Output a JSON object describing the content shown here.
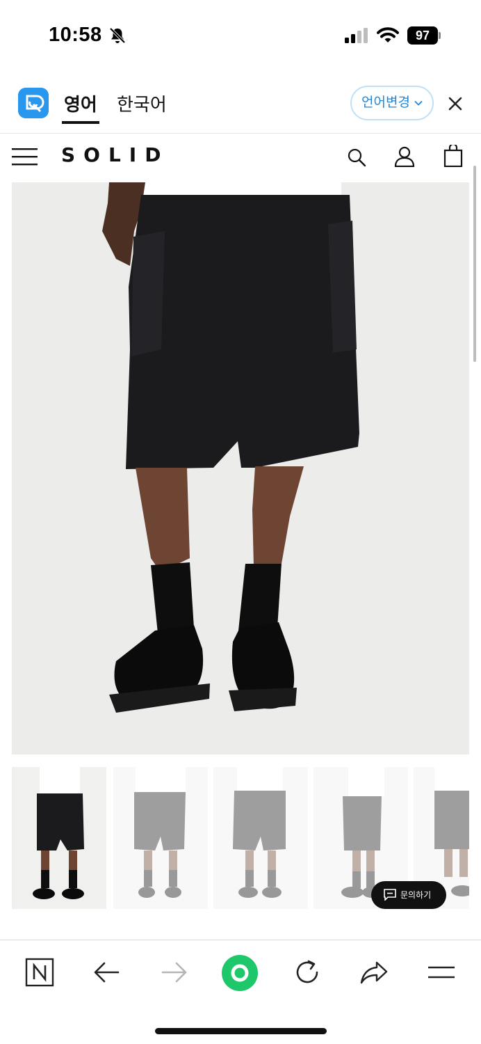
{
  "status_bar": {
    "time": "10:58",
    "battery": "97"
  },
  "translate_bar": {
    "tab_english": "영어",
    "tab_korean": "한국어",
    "change_language": "언어변경"
  },
  "site": {
    "brand": "SOLID"
  },
  "inquiry_button": {
    "label": "문의하기"
  },
  "colors": {
    "link_blue": "#1f86d8",
    "refresh_green": "#1ec86a"
  }
}
